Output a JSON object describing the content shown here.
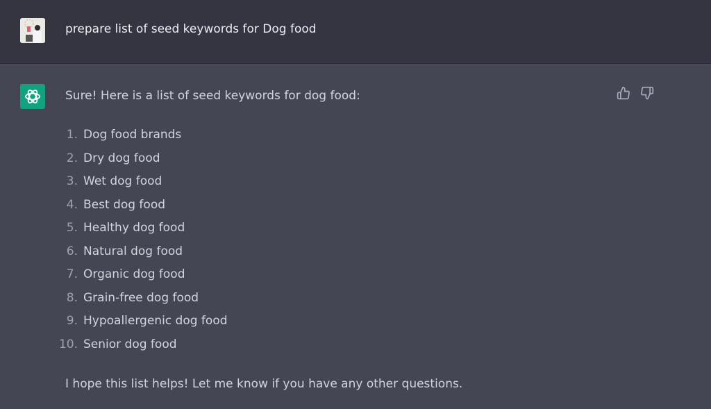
{
  "user_message": {
    "text": "prepare list of seed keywords for Dog food",
    "avatar": "user-photo-avatar"
  },
  "assistant_message": {
    "avatar": "openai-logo-icon",
    "intro": "Sure! Here is a list of seed keywords for dog food:",
    "items": [
      {
        "num": "1.",
        "text": "Dog food brands"
      },
      {
        "num": "2.",
        "text": "Dry dog food"
      },
      {
        "num": "3.",
        "text": "Wet dog food"
      },
      {
        "num": "4.",
        "text": "Best dog food"
      },
      {
        "num": "5.",
        "text": "Healthy dog food"
      },
      {
        "num": "6.",
        "text": "Natural dog food"
      },
      {
        "num": "7.",
        "text": "Organic dog food"
      },
      {
        "num": "8.",
        "text": "Grain-free dog food"
      },
      {
        "num": "9.",
        "text": "Hypoallergenic dog food"
      },
      {
        "num": "10.",
        "text": "Senior dog food"
      }
    ],
    "outro": "I hope this list helps! Let me know if you have any other questions.",
    "feedback": {
      "like": "thumbs-up-icon",
      "dislike": "thumbs-down-icon"
    }
  },
  "colors": {
    "user_bg": "#343541",
    "assistant_bg": "#444654",
    "accent": "#10a37f"
  }
}
